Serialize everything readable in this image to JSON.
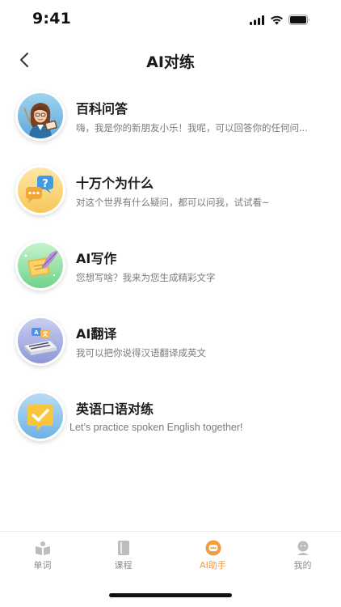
{
  "status_bar": {
    "time": "9:41"
  },
  "nav": {
    "title": "AI对练"
  },
  "features": [
    {
      "title": "百科问答",
      "description": "嗨，我是你的新朋友小乐！我呢，可以回答你的任何问...",
      "icon": "teacher-avatar-icon"
    },
    {
      "title": "十万个为什么",
      "description": "对这个世界有什么疑问，都可以问我，试试看~",
      "icon": "question-bubble-icon"
    },
    {
      "title": "AI写作",
      "description": "您想写啥？我来为您生成精彩文字",
      "icon": "quill-writing-icon"
    },
    {
      "title": "AI翻译",
      "description": "我可以把你说得汉语翻译成英文",
      "icon": "translate-device-icon"
    },
    {
      "title": "英语口语对练",
      "description": "Let’s practice spoken English together!",
      "icon": "checkmark-badge-icon"
    }
  ],
  "tabs": [
    {
      "label": "单词",
      "icon": "book-open-icon",
      "active": false
    },
    {
      "label": "课程",
      "icon": "notebook-icon",
      "active": false
    },
    {
      "label": "AI助手",
      "icon": "ai-assistant-icon",
      "active": true
    },
    {
      "label": "我的",
      "icon": "profile-icon",
      "active": false
    }
  ],
  "colors": {
    "accent": "#f39a3d",
    "inactive_tab": "#8c8c8c",
    "title_text": "#1c1c1c",
    "desc_text": "#7a7a7a"
  }
}
